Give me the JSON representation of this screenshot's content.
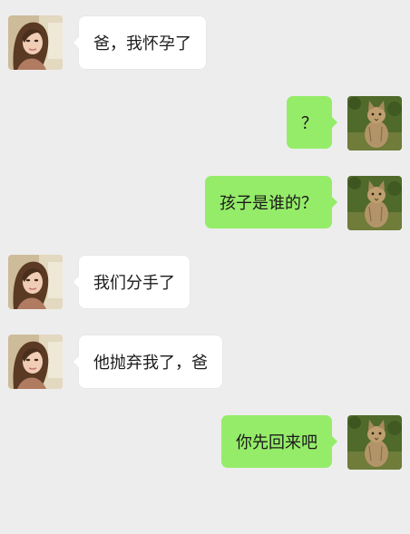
{
  "conversation": {
    "messages": [
      {
        "side": "left",
        "sender": "girl",
        "text": "爸，我怀孕了"
      },
      {
        "side": "right",
        "sender": "father",
        "text": "？"
      },
      {
        "side": "right",
        "sender": "father",
        "text": "孩子是谁的？"
      },
      {
        "side": "left",
        "sender": "girl",
        "text": "我们分手了"
      },
      {
        "side": "left",
        "sender": "girl",
        "text": "他抛弃我了，爸"
      },
      {
        "side": "right",
        "sender": "father",
        "text": "你先回来吧"
      }
    ]
  },
  "colors": {
    "background": "#ededed",
    "incoming_bubble": "#ffffff",
    "outgoing_bubble": "#95ec69",
    "text": "#1b1b1b"
  },
  "avatars": {
    "girl": "girl-avatar",
    "father": "cat-avatar"
  }
}
